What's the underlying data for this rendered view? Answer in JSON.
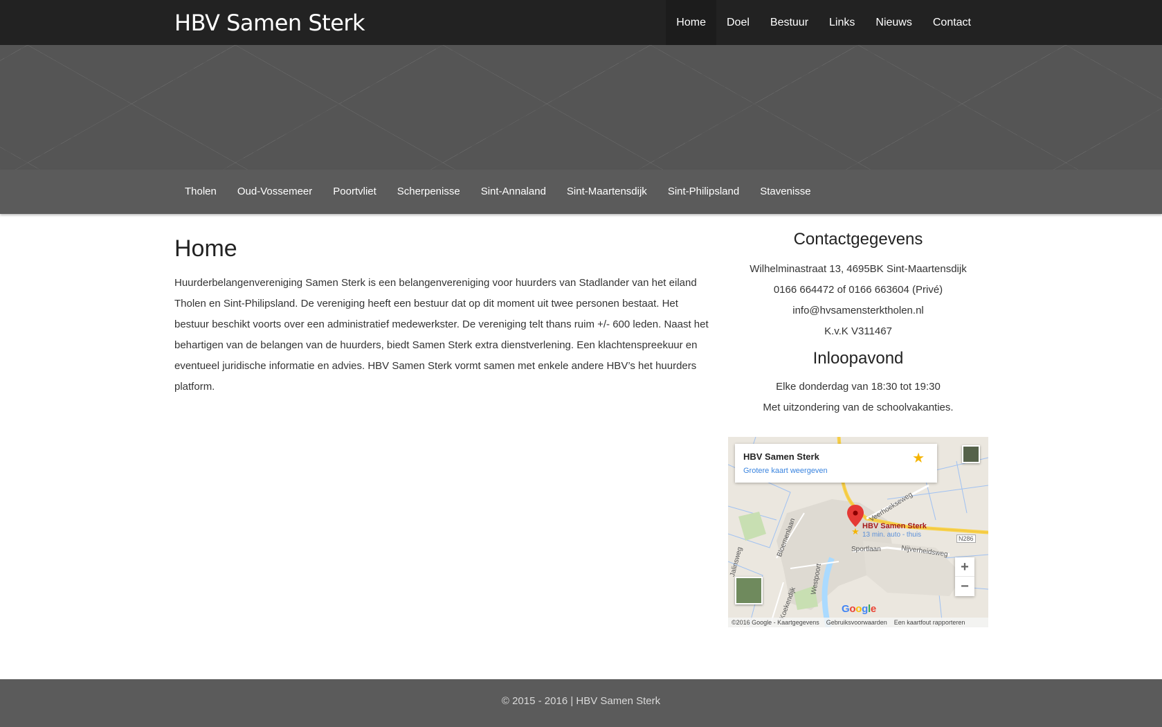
{
  "brand": "HBV Samen Sterk",
  "topnav": [
    "Home",
    "Doel",
    "Bestuur",
    "Links",
    "Nieuws",
    "Contact"
  ],
  "subnav": [
    "Tholen",
    "Oud-Vossemeer",
    "Poortvliet",
    "Scherpenisse",
    "Sint-Annaland",
    "Sint-Maartensdijk",
    "Sint-Philipsland",
    "Stavenisse"
  ],
  "main": {
    "title": "Home",
    "text": "Huurderbelangenvereniging Samen Sterk is een belangenvereniging voor huurders van Stadlander van het eiland Tholen en Sint-Philipsland. De vereniging heeft een bestuur dat op dit moment uit twee personen bestaat. Het bestuur beschikt voorts over een administratief medewerkster. De vereniging telt thans ruim +/- 600 leden. Naast het behartigen van de belangen van de huurders, biedt Samen Sterk extra dienstverlening. Een klachtenspreekuur en eventueel juridische informatie en advies. HBV Samen Sterk vormt samen met enkele andere HBV’s het huurders platform."
  },
  "contact": {
    "title": "Contactgegevens",
    "address": "Wilhelminastraat 13, 4695BK Sint-Maartensdijk",
    "phone": "0166 664472 of 0166 663604 (Privé)",
    "email": "info@hvsamensterktholen.nl",
    "kvk": "K.v.K V311467"
  },
  "inloop": {
    "title": "Inloopavond",
    "line1": "Elke donderdag van 18:30 tot 19:30",
    "line2": "Met uitzondering van de schoolvakanties."
  },
  "map": {
    "card_title": "HBV Samen Sterk",
    "card_link": "Grotere kaart weergeven",
    "pin_label": "HBV Samen Sterk",
    "pin_sub": "13 min. auto - thuis",
    "roads": [
      "Veerhoekseweg",
      "Bloemenlaan",
      "Sportlaan",
      "Nijverheidsweg",
      "Westpoort",
      "N286",
      "Jalinsweg",
      "Koekendijk"
    ],
    "zoom_in": "+",
    "zoom_out": "−",
    "footer": [
      "©2016 Google - Kaartgegevens",
      "Gebruiksvoorwaarden",
      "Een kaartfout rapporteren"
    ]
  },
  "footer": "© 2015 - 2016 | HBV Samen Sterk",
  "colors": {
    "topbar": "#222222",
    "subnav": "#5b5b5b",
    "footer": "#5b5b5b",
    "map_link": "#3a84df",
    "star": "#f5b400",
    "pin": "#e53935"
  }
}
